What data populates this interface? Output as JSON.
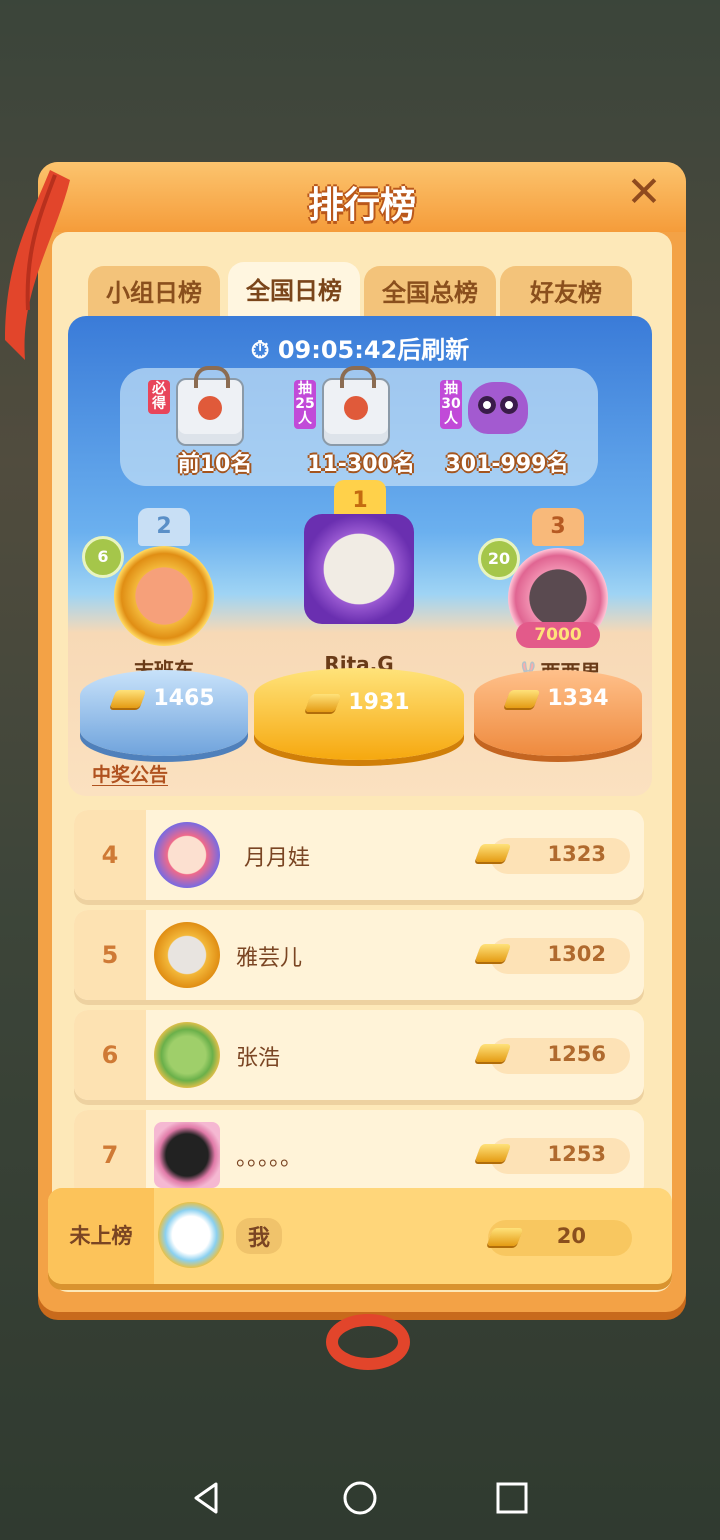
{
  "title": "排行榜",
  "tabs": [
    {
      "label": "小组日榜",
      "active": false
    },
    {
      "label": "全国日榜",
      "active": true
    },
    {
      "label": "全国总榜",
      "active": false
    },
    {
      "label": "好友榜",
      "active": false
    }
  ],
  "timer": "09:05:42后刷新",
  "rewards": [
    {
      "tag": "必得",
      "label": "前10名",
      "tag_color": "#e8455a",
      "icon": "gift-bag-icon"
    },
    {
      "tag": "抽25人",
      "label": "11-300名",
      "tag_color": "#c14ad8",
      "icon": "gift-bag-icon"
    },
    {
      "tag": "抽30人",
      "label": "301-999名",
      "tag_color": "#c14ad8",
      "icon": "owl-plush-icon"
    }
  ],
  "podium": [
    {
      "rank": "2",
      "name": "末班车",
      "score": "1465",
      "level": "6",
      "color": "#9cc4ef"
    },
    {
      "rank": "1",
      "name": "Rita.G",
      "score": "1931",
      "level": "",
      "color": "#ffc53a"
    },
    {
      "rank": "3",
      "name": "西西里",
      "score": "1334",
      "level": "20",
      "badge": "7000",
      "color": "#f4a35d"
    }
  ],
  "notice": "中奖公告",
  "rows": [
    {
      "rank": "4",
      "name": "月月娃",
      "score": "1323"
    },
    {
      "rank": "5",
      "name": "雅芸儿",
      "score": "1302"
    },
    {
      "rank": "6",
      "name": "张浩",
      "score": "1256"
    },
    {
      "rank": "7",
      "name": "。。。。。",
      "score": "1253"
    }
  ],
  "me": {
    "rank": "未上榜",
    "name": "我",
    "score": "20"
  },
  "colors": {
    "accent": "#f3a246",
    "panel_bg": "#fde8b8",
    "rank_text": "#cf7a35"
  }
}
